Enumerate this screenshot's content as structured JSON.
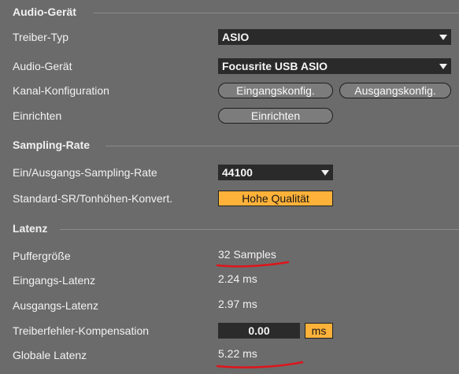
{
  "audio_device_section": {
    "title": "Audio-Gerät",
    "driver_type_label": "Treiber-Typ",
    "driver_type_value": "ASIO",
    "audio_device_label": "Audio-Gerät",
    "audio_device_value": "Focusrite USB ASIO",
    "channel_config_label": "Kanal-Konfiguration",
    "input_config_button": "Eingangskonfig.",
    "output_config_button": "Ausgangskonfig.",
    "setup_label": "Einrichten",
    "setup_button": "Einrichten"
  },
  "sampling_section": {
    "title": "Sampling-Rate",
    "io_rate_label": "Ein/Ausgangs-Sampling-Rate",
    "io_rate_value": "44100",
    "standard_sr_label": "Standard-SR/Tonhöhen-Konvert.",
    "standard_sr_value": "Hohe Qualität"
  },
  "latency_section": {
    "title": "Latenz",
    "buffer_label": "Puffergröße",
    "buffer_value": "32 Samples",
    "input_latency_label": "Eingangs-Latenz",
    "input_latency_value": "2.24 ms",
    "output_latency_label": "Ausgangs-Latenz",
    "output_latency_value": "2.97 ms",
    "driver_comp_label": "Treiberfehler-Kompensation",
    "driver_comp_value": "0.00",
    "driver_comp_unit": "ms",
    "global_latency_label": "Globale Latenz",
    "global_latency_value": "5.22 ms"
  },
  "colors": {
    "background": "#6b6b6b",
    "field": "#2a2a2a",
    "accent_orange": "#ffb23a",
    "annotation_red": "#e0141b"
  }
}
